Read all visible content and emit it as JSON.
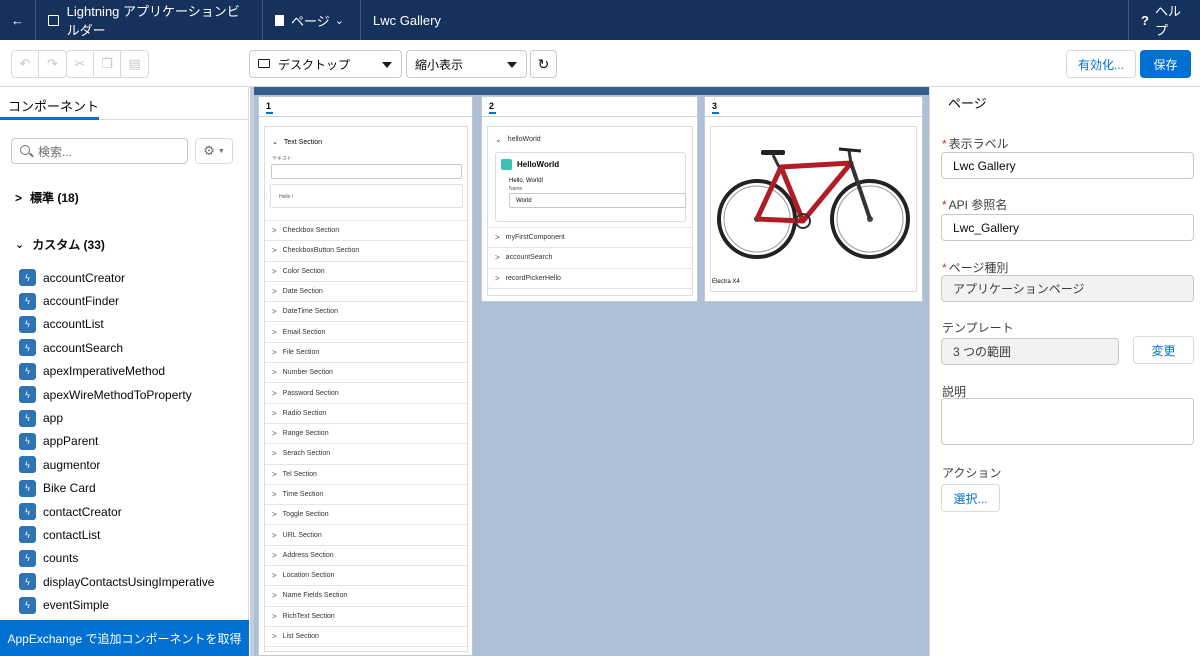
{
  "header": {
    "app_title": "Lightning アプリケーションビルダー",
    "page_menu": "ページ",
    "page_name": "Lwc Gallery",
    "help": "ヘルプ"
  },
  "toolbar": {
    "device": "デスクトップ",
    "zoom": "縮小表示",
    "activate": "有効化...",
    "save": "保存"
  },
  "left": {
    "tab": "コンポーネント",
    "search_placeholder": "検索...",
    "standard": "標準 (18)",
    "custom": "カスタム (33)",
    "components": [
      "accountCreator",
      "accountFinder",
      "accountList",
      "accountSearch",
      "apexImperativeMethod",
      "apexWireMethodToProperty",
      "app",
      "appParent",
      "augmentor",
      "Bike Card",
      "contactCreator",
      "contactList",
      "counts",
      "displayContactsUsingImperative",
      "eventSimple"
    ],
    "appexchange": "AppExchange で追加コンポーネントを取得"
  },
  "canvas": {
    "col1": {
      "label": "1",
      "first": "Text Section",
      "field_label": "テキスト",
      "text_value": "Hello !",
      "sections": [
        "Checkbox Section",
        "CheckboxButton Section",
        "Color Section",
        "Date Section",
        "DateTime Section",
        "Email Section",
        "File Section",
        "Number Section",
        "Password Section",
        "Radio Section",
        "Range Section",
        "Serach Section",
        "Tel Section",
        "Time Section",
        "Toggle Section",
        "URL Section",
        "Address Section",
        "Location Section",
        "Name Fields Section",
        "RichText Section",
        "List Section"
      ]
    },
    "col2": {
      "label": "2",
      "first": "helloWorld",
      "card_title": "HelloWorld",
      "greeting": "Hello, World!",
      "name_label": "Name",
      "name_value": "World",
      "sections": [
        "myFirstComponent",
        "accountSearch",
        "recordPickerHello"
      ]
    },
    "col3": {
      "label": "3",
      "caption": "Electra X4"
    }
  },
  "props": {
    "tab": "ページ",
    "label_label": "表示ラベル",
    "label_value": "Lwc Gallery",
    "api_label": "API 参照名",
    "api_value": "Lwc_Gallery",
    "type_label": "ページ種別",
    "type_value": "アプリケーションページ",
    "template_label": "テンプレート",
    "template_value": "3 つの範囲",
    "change": "変更",
    "desc_label": "説明",
    "action_label": "アクション",
    "select": "選択..."
  }
}
